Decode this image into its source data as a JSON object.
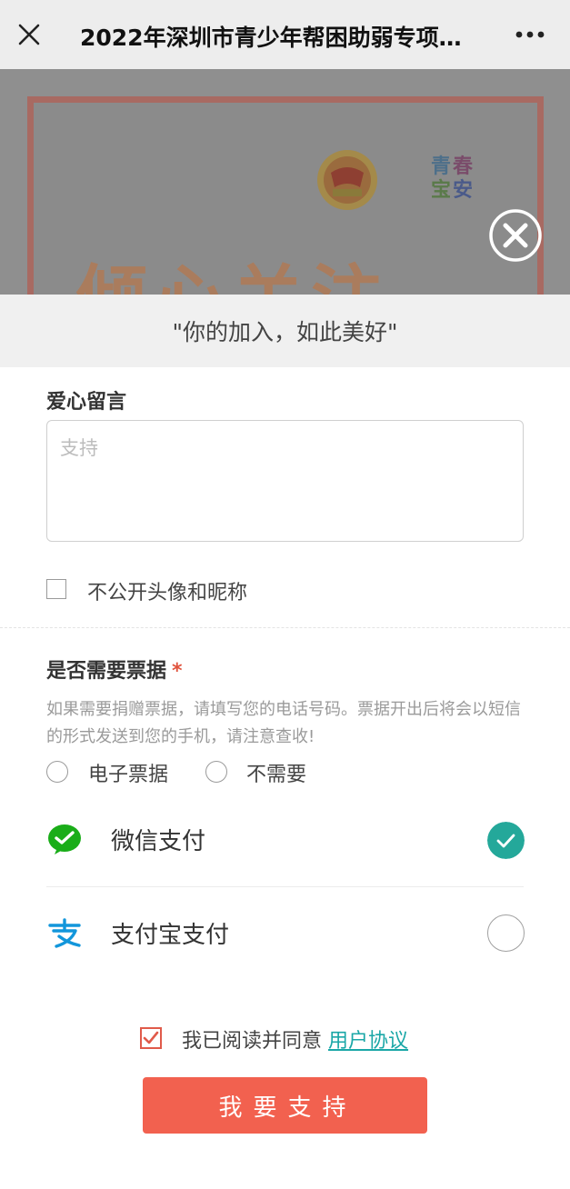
{
  "header": {
    "title": "2022年深圳市青少年帮困助弱专项…"
  },
  "banner": {
    "big_text": "倾心关注",
    "logo_chars": [
      "青",
      "春",
      "宝",
      "安"
    ]
  },
  "quote": "\"你的加入，如此美好\"",
  "message": {
    "label": "爱心留言",
    "placeholder": "支持",
    "value": ""
  },
  "anonymous": {
    "label": "不公开头像和昵称",
    "checked": false
  },
  "invoice": {
    "label": "是否需要票据",
    "required_mark": "*",
    "hint": "如果需要捐赠票据，请填写您的电话号码。票据开出后将会以短信的形式发送到您的手机，请注意查收!",
    "options": [
      {
        "label": "电子票据",
        "selected": false
      },
      {
        "label": "不需要",
        "selected": false
      }
    ]
  },
  "payment": {
    "methods": [
      {
        "label": "微信支付",
        "icon": "wechat-pay-icon",
        "selected": true,
        "color": "#1aad19"
      },
      {
        "label": "支付宝支付",
        "icon": "alipay-icon",
        "selected": false,
        "color": "#1296db"
      }
    ]
  },
  "agreement": {
    "text": "我已阅读并同意",
    "link": "用户协议",
    "checked": true
  },
  "submit_label": "我要支持",
  "colors": {
    "accent": "#f2614f",
    "check_teal": "#24a89a",
    "link": "#1aa7a7"
  }
}
